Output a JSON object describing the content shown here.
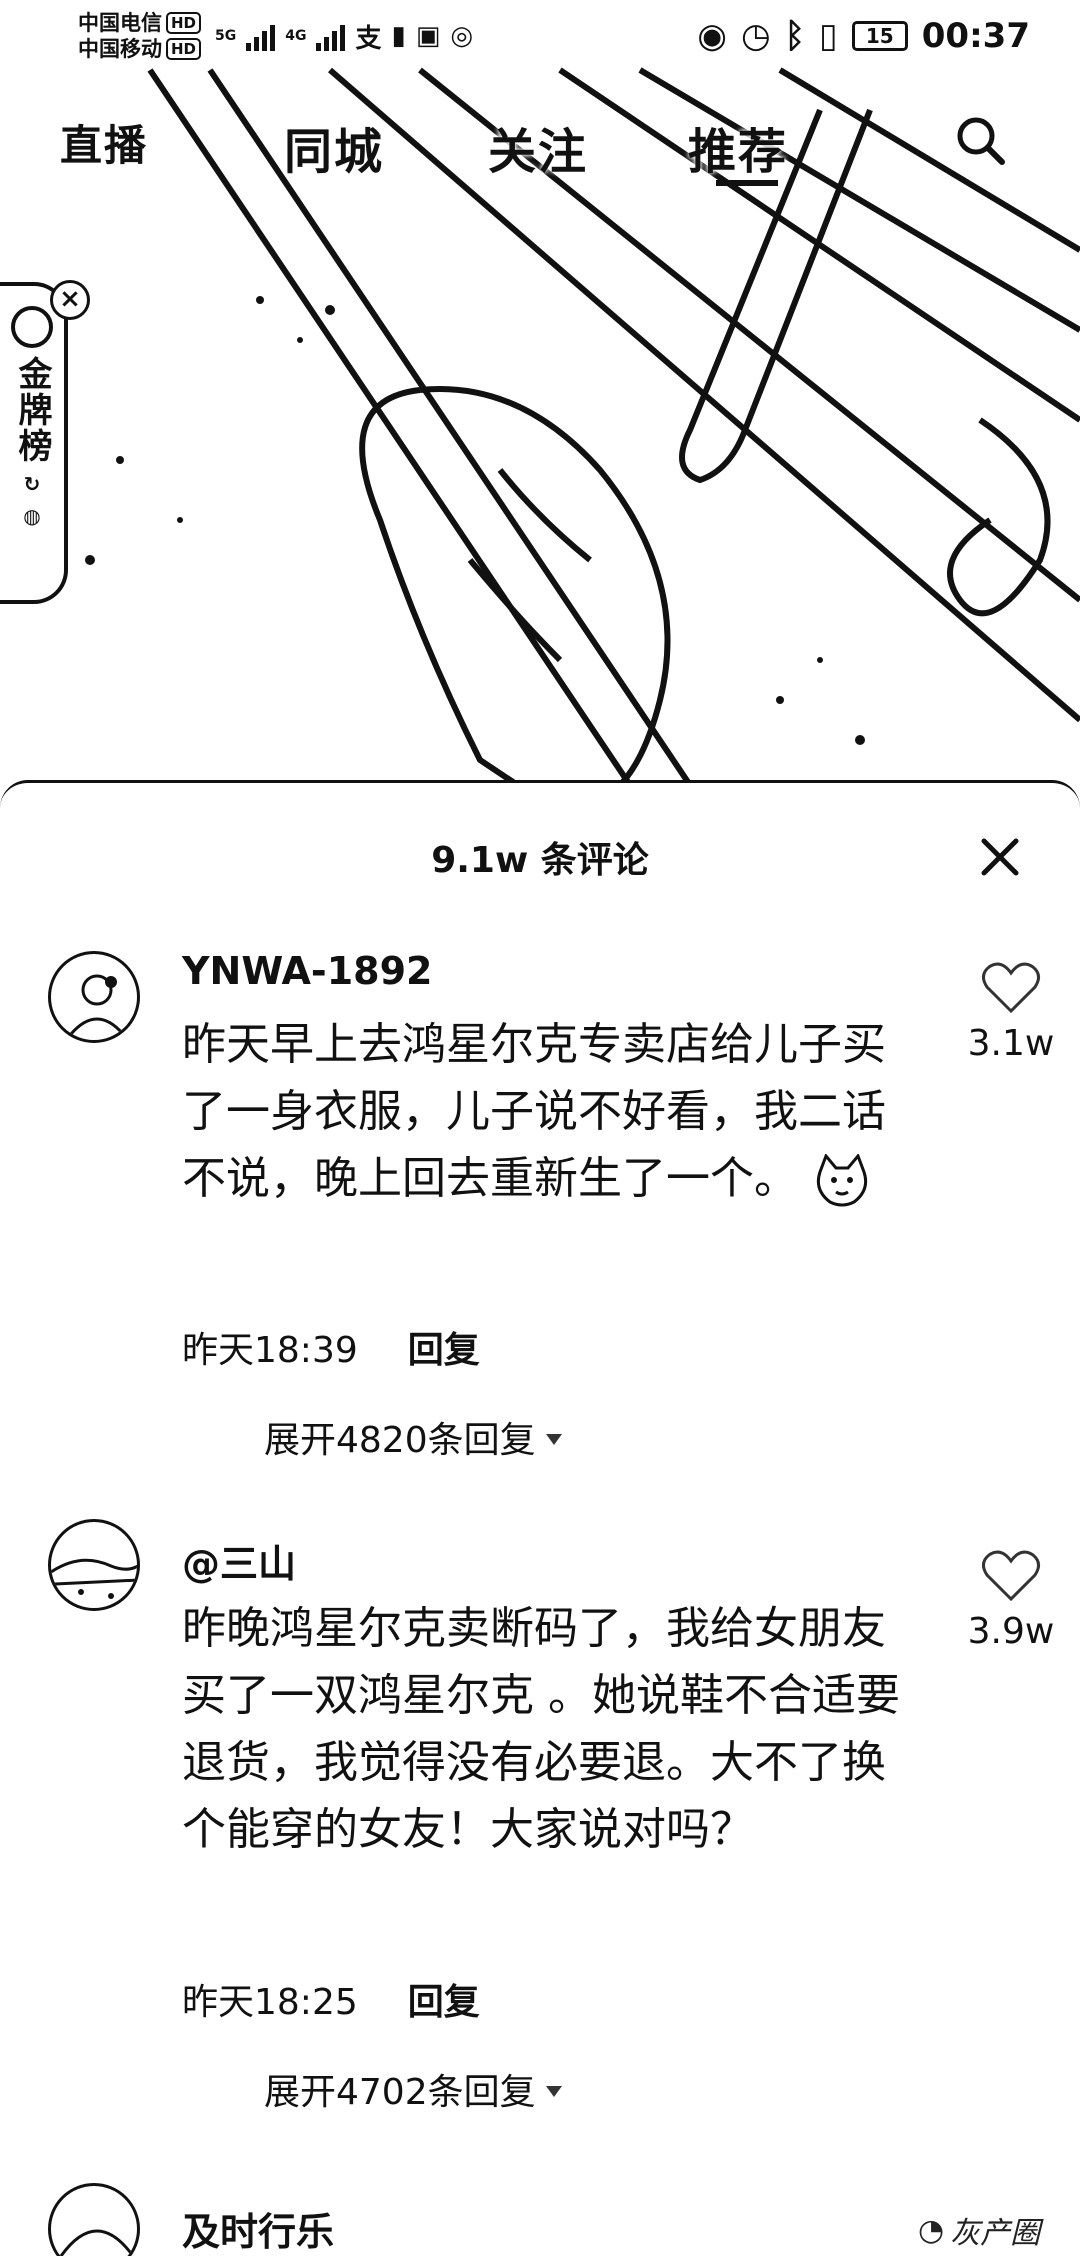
{
  "status_bar": {
    "carrier_1": "中国电信",
    "carrier_2": "中国移动",
    "hd_label": "HD",
    "network_5g": "5G",
    "network_4g": "4G",
    "battery": "15",
    "time": "00:37"
  },
  "top_nav": {
    "tabs": [
      "直播",
      "同城",
      "关注",
      "推荐"
    ],
    "active_tab": "推荐"
  },
  "side_badge": {
    "label": "金牌榜"
  },
  "comments_sheet": {
    "title": "9.1w 条评论",
    "comments": [
      {
        "username": "YNWA-1892",
        "text": "昨天早上去鸿星尔克专卖店给儿子买了一身衣服，儿子说不好看，我二话不说，晚上回去重新生了一个。",
        "time": "昨天18:39",
        "reply_label": "回复",
        "expand_label": "展开4820条回复",
        "likes": "3.1w"
      },
      {
        "username": "@三山",
        "text": "昨晚鸿星尔克卖断码了，我给女朋友买了一双鸿星尔克 。她说鞋不合适要退货，我觉得没有必要退。大不了换个能穿的女友！大家说对吗？",
        "time": "昨天18:25",
        "reply_label": "回复",
        "expand_label": "展开4702条回复",
        "likes": "3.9w"
      },
      {
        "username": "及时行乐"
      }
    ]
  },
  "watermark": "灰产圈"
}
